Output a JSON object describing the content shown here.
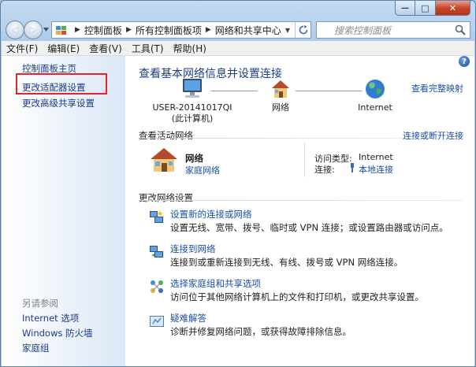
{
  "titlebar": {
    "minimize_glyph": "—",
    "maximize_glyph": "□",
    "close_glyph": "✕"
  },
  "navigation": {
    "back_glyph": "◀",
    "forward_glyph": "▶",
    "breadcrumbs": [
      "控制面板",
      "所有控制面板项",
      "网络和共享中心"
    ],
    "search_placeholder": "搜索控制面板"
  },
  "menubar": {
    "items": [
      "文件(F)",
      "编辑(E)",
      "查看(V)",
      "工具(T)",
      "帮助(H)"
    ]
  },
  "sidebar": {
    "items": [
      "控制面板主页",
      "更改适配器设置",
      "更改高级共享设置"
    ],
    "selected": "更改适配器设置",
    "see_also_label": "另请参阅",
    "see_also_items": [
      "Internet 选项",
      "Windows 防火墙",
      "家庭组"
    ]
  },
  "main": {
    "help_glyph": "?",
    "heading": "查看基本网络信息并设置连接",
    "see_full_map": "查看完整映射",
    "map": {
      "computer_name": "USER-20141017QI",
      "computer_sub": "(此计算机)",
      "network": "网络",
      "internet": "Internet"
    },
    "active_networks": {
      "header": "查看活动网络",
      "connect_link": "连接或断开连接",
      "network_name": "网络",
      "network_type": "家庭网络",
      "access_type_label": "访问类型:",
      "access_type_value": "Internet",
      "connections_label": "连接:",
      "connections_value": "本地连接"
    },
    "change_settings": {
      "header": "更改网络设置",
      "tasks": [
        {
          "title": "设置新的连接或网络",
          "desc": "设置无线、宽带、拨号、临时或 VPN 连接；或设置路由器或访问点。",
          "icon": "new-connection-icon"
        },
        {
          "title": "连接到网络",
          "desc": "连接到或重新连接到无线、有线、拨号或 VPN 网络连接。",
          "icon": "connect-network-icon"
        },
        {
          "title": "选择家庭组和共享选项",
          "desc": "访问位于其他网络计算机上的文件和打印机，或更改共享设置。",
          "icon": "homegroup-icon"
        },
        {
          "title": "疑难解答",
          "desc": "诊断并修复网络问题，或获得故障排除信息。",
          "icon": "troubleshoot-icon"
        }
      ]
    }
  },
  "colors": {
    "link": "#1a4ea5",
    "heading": "#1b3e86",
    "selection_box": "#e0262a"
  }
}
